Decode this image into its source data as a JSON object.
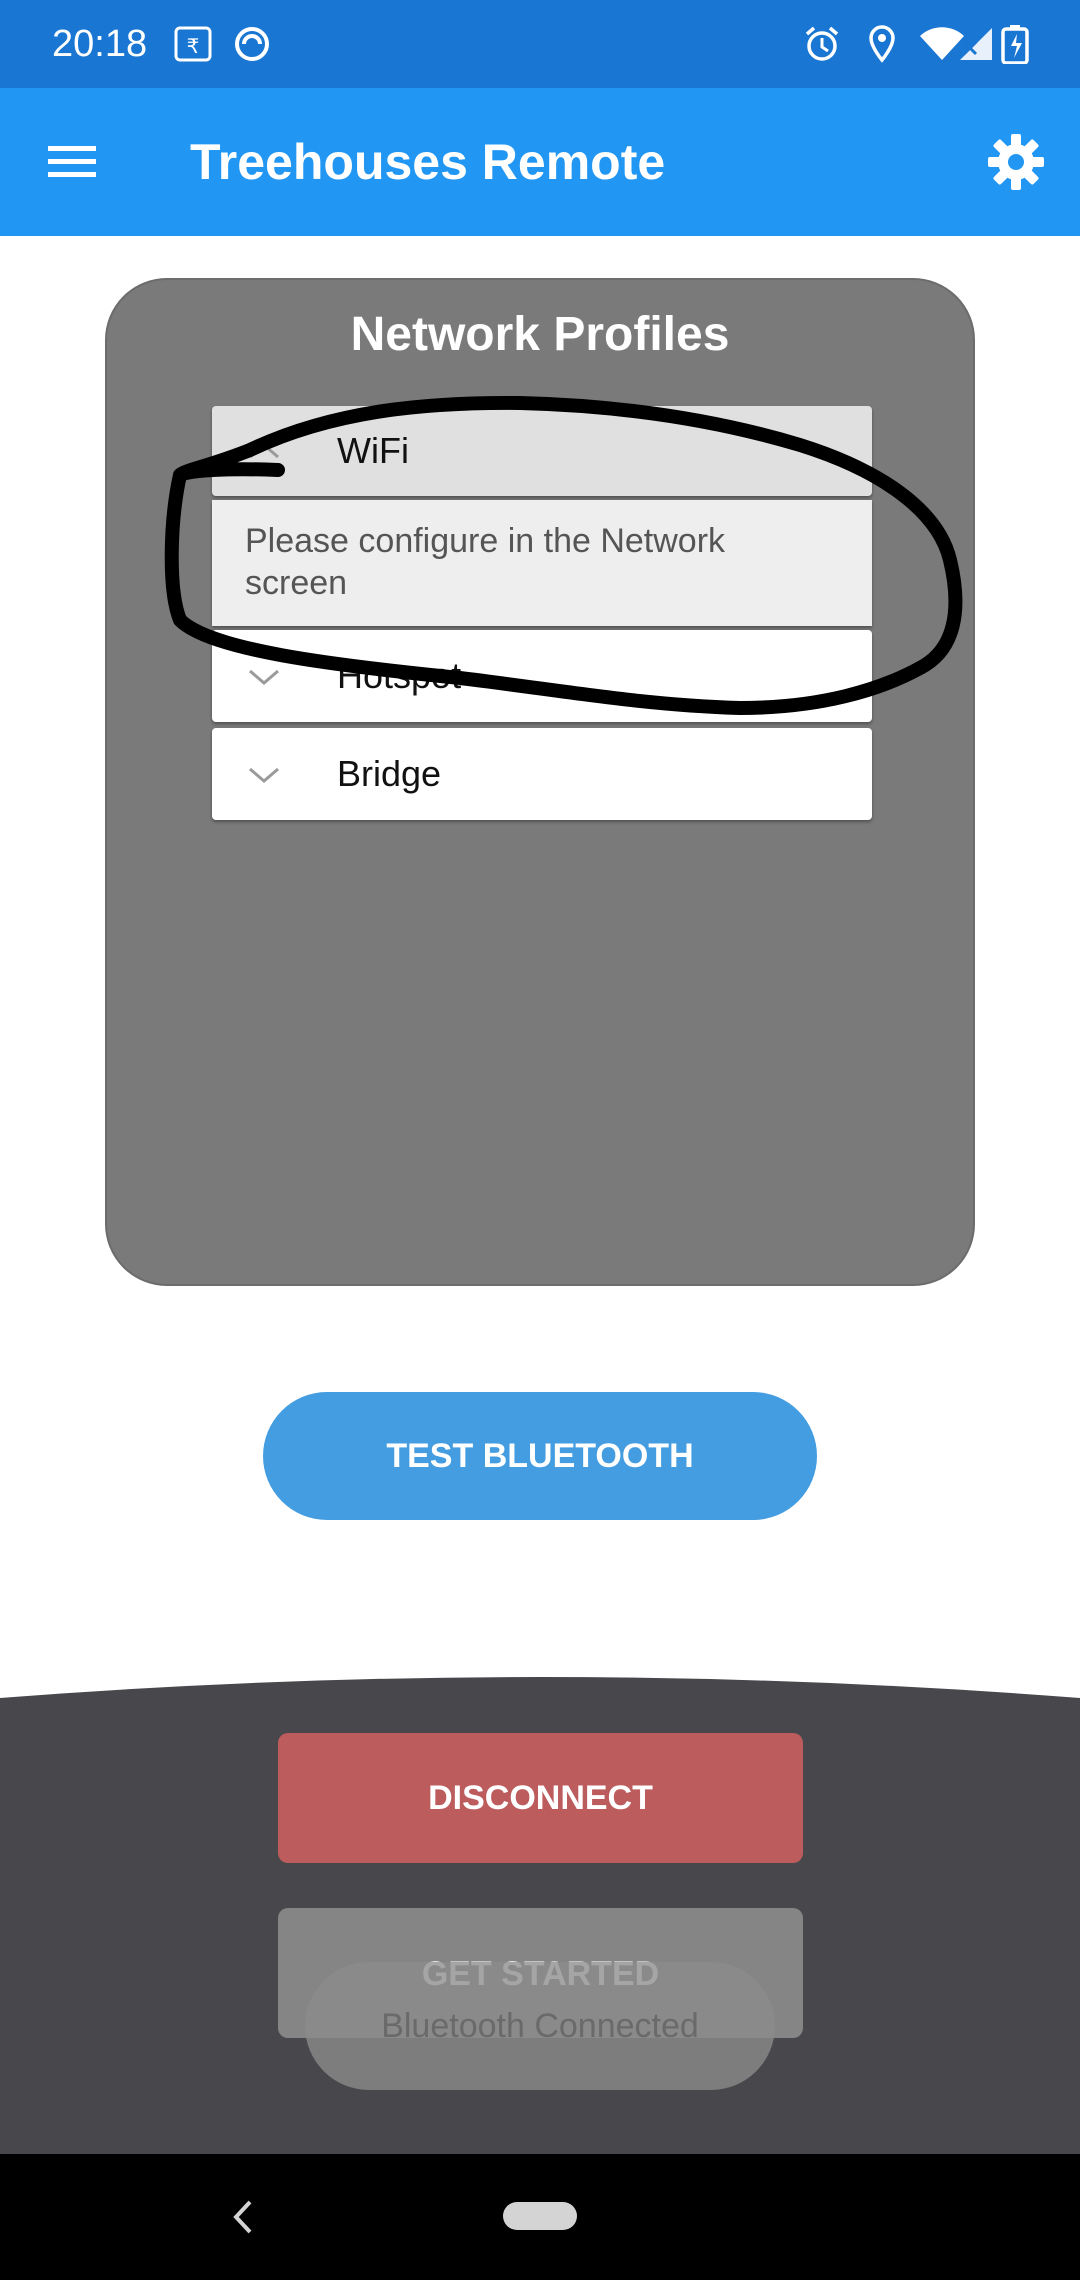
{
  "status_bar": {
    "time": "20:18",
    "left_icons": [
      "rupee-icon",
      "data-saver-icon"
    ],
    "right_icons": [
      "alarm-icon",
      "location-icon",
      "wifi-icon",
      "signal-icon",
      "battery-charging-icon"
    ]
  },
  "app_bar": {
    "title": "Treehouses Remote",
    "menu_icon": "hamburger-menu-icon",
    "settings_icon": "gear-icon",
    "color": "#2196f3"
  },
  "network_card": {
    "title": "Network Profiles",
    "profiles": [
      {
        "label": "WiFi",
        "expanded": true,
        "message": "Please configure in the Network screen"
      },
      {
        "label": "Hotspot",
        "expanded": false
      },
      {
        "label": "Bridge",
        "expanded": false
      }
    ]
  },
  "buttons": {
    "test_bluetooth": "TEST BLUETOOTH",
    "disconnect": "DISCONNECT",
    "get_started": "GET STARTED"
  },
  "toast": {
    "text": "Bluetooth Connected"
  },
  "colors": {
    "status_bar": "#1976d2",
    "test_button": "#449de0",
    "disconnect_button": "#bc5c5d",
    "bottom_panel": "#48484c"
  }
}
